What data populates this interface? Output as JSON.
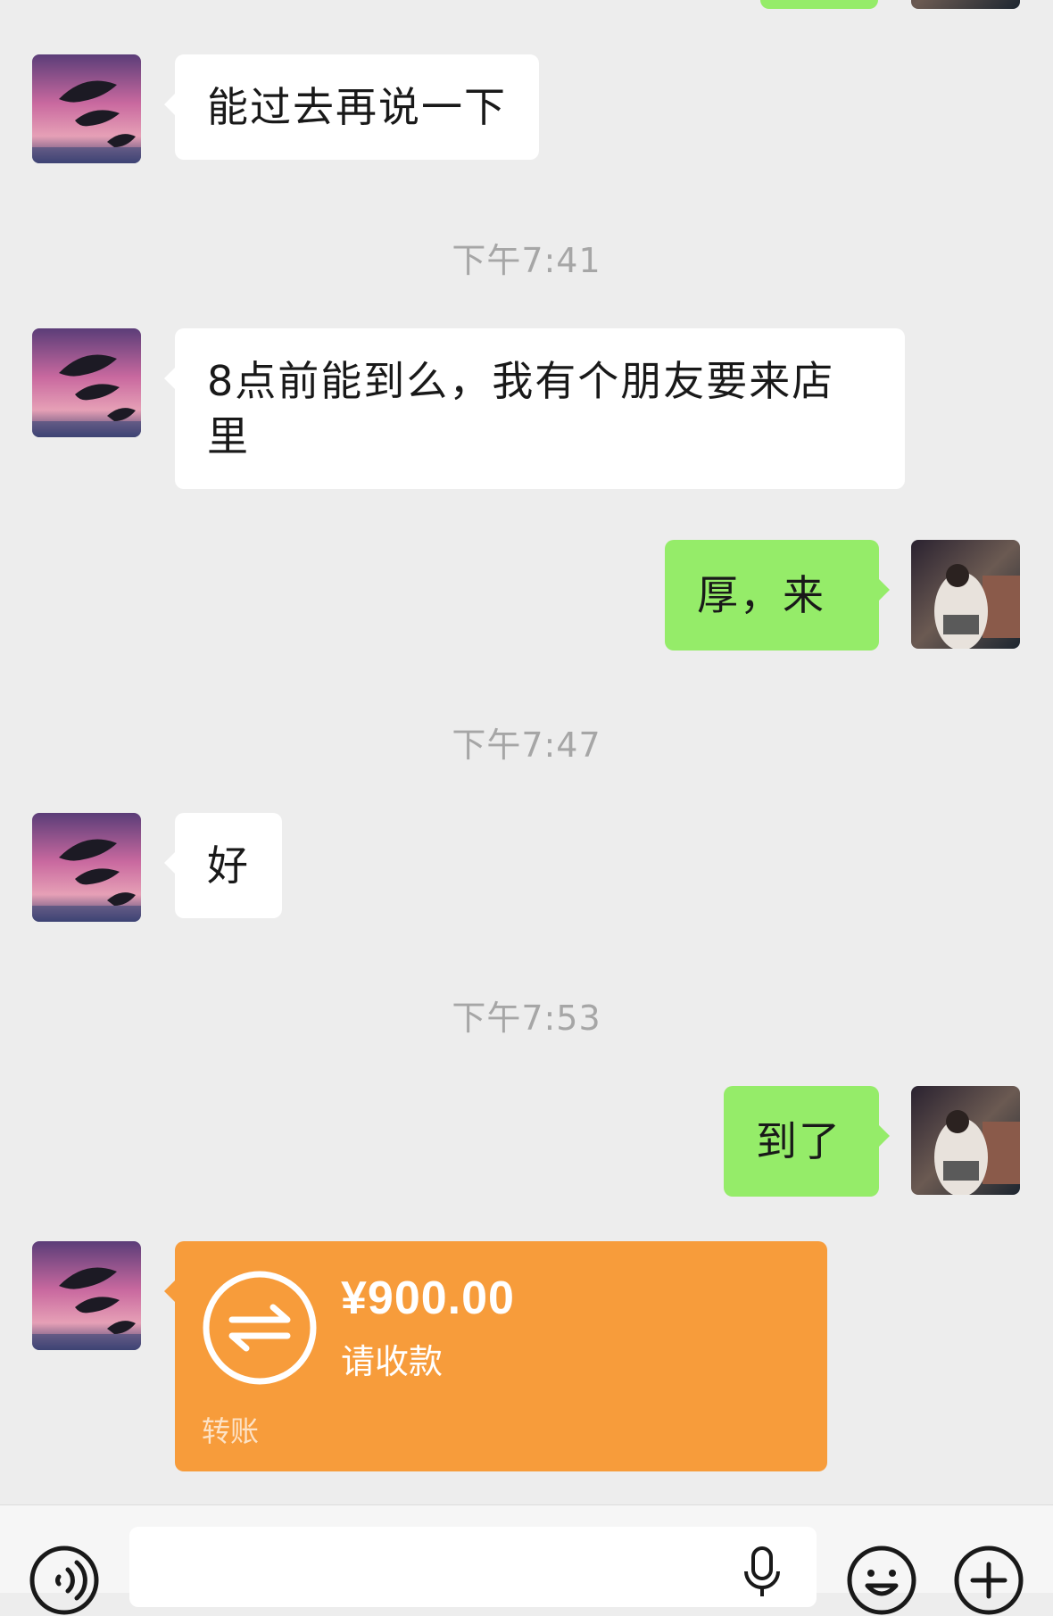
{
  "chat": {
    "messages": [
      {
        "text": "能过去再说一下"
      },
      {
        "text": "8点前能到么，我有个朋友要来店里"
      },
      {
        "text": "厚，来"
      },
      {
        "text": "好"
      },
      {
        "text": "到了"
      }
    ],
    "timestamps": [
      "下午7:41",
      "下午7:47",
      "下午7:53"
    ],
    "transfer": {
      "amount": "¥900.00",
      "status": "请收款",
      "label": "转账",
      "color": "#f79c3b"
    }
  },
  "colors": {
    "background": "#ededed",
    "incoming_bubble": "#ffffff",
    "outgoing_bubble": "#95ec69",
    "timestamp_text": "#a6a6a6"
  },
  "icons": {
    "voice": "voice-icon",
    "mic": "mic-icon",
    "emoji": "emoji-icon",
    "more": "plus-icon",
    "transfer": "transfer-arrows-icon"
  }
}
